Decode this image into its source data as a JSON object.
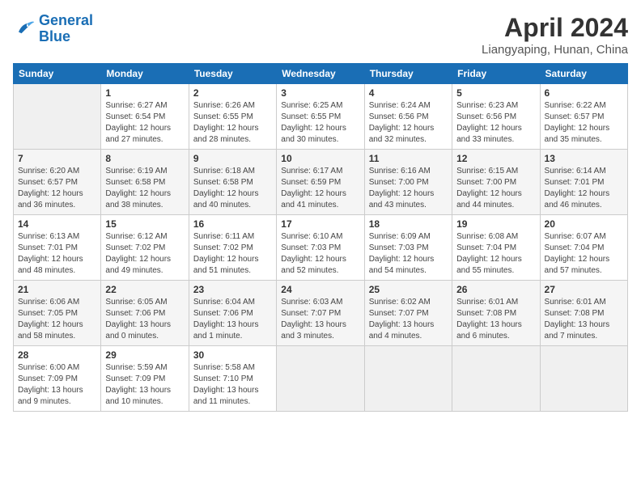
{
  "logo": {
    "line1": "General",
    "line2": "Blue"
  },
  "title": "April 2024",
  "location": "Liangyaping, Hunan, China",
  "days_header": [
    "Sunday",
    "Monday",
    "Tuesday",
    "Wednesday",
    "Thursday",
    "Friday",
    "Saturday"
  ],
  "weeks": [
    [
      {
        "day": "",
        "info": ""
      },
      {
        "day": "1",
        "info": "Sunrise: 6:27 AM\nSunset: 6:54 PM\nDaylight: 12 hours\nand 27 minutes."
      },
      {
        "day": "2",
        "info": "Sunrise: 6:26 AM\nSunset: 6:55 PM\nDaylight: 12 hours\nand 28 minutes."
      },
      {
        "day": "3",
        "info": "Sunrise: 6:25 AM\nSunset: 6:55 PM\nDaylight: 12 hours\nand 30 minutes."
      },
      {
        "day": "4",
        "info": "Sunrise: 6:24 AM\nSunset: 6:56 PM\nDaylight: 12 hours\nand 32 minutes."
      },
      {
        "day": "5",
        "info": "Sunrise: 6:23 AM\nSunset: 6:56 PM\nDaylight: 12 hours\nand 33 minutes."
      },
      {
        "day": "6",
        "info": "Sunrise: 6:22 AM\nSunset: 6:57 PM\nDaylight: 12 hours\nand 35 minutes."
      }
    ],
    [
      {
        "day": "7",
        "info": "Sunrise: 6:20 AM\nSunset: 6:57 PM\nDaylight: 12 hours\nand 36 minutes."
      },
      {
        "day": "8",
        "info": "Sunrise: 6:19 AM\nSunset: 6:58 PM\nDaylight: 12 hours\nand 38 minutes."
      },
      {
        "day": "9",
        "info": "Sunrise: 6:18 AM\nSunset: 6:58 PM\nDaylight: 12 hours\nand 40 minutes."
      },
      {
        "day": "10",
        "info": "Sunrise: 6:17 AM\nSunset: 6:59 PM\nDaylight: 12 hours\nand 41 minutes."
      },
      {
        "day": "11",
        "info": "Sunrise: 6:16 AM\nSunset: 7:00 PM\nDaylight: 12 hours\nand 43 minutes."
      },
      {
        "day": "12",
        "info": "Sunrise: 6:15 AM\nSunset: 7:00 PM\nDaylight: 12 hours\nand 44 minutes."
      },
      {
        "day": "13",
        "info": "Sunrise: 6:14 AM\nSunset: 7:01 PM\nDaylight: 12 hours\nand 46 minutes."
      }
    ],
    [
      {
        "day": "14",
        "info": "Sunrise: 6:13 AM\nSunset: 7:01 PM\nDaylight: 12 hours\nand 48 minutes."
      },
      {
        "day": "15",
        "info": "Sunrise: 6:12 AM\nSunset: 7:02 PM\nDaylight: 12 hours\nand 49 minutes."
      },
      {
        "day": "16",
        "info": "Sunrise: 6:11 AM\nSunset: 7:02 PM\nDaylight: 12 hours\nand 51 minutes."
      },
      {
        "day": "17",
        "info": "Sunrise: 6:10 AM\nSunset: 7:03 PM\nDaylight: 12 hours\nand 52 minutes."
      },
      {
        "day": "18",
        "info": "Sunrise: 6:09 AM\nSunset: 7:03 PM\nDaylight: 12 hours\nand 54 minutes."
      },
      {
        "day": "19",
        "info": "Sunrise: 6:08 AM\nSunset: 7:04 PM\nDaylight: 12 hours\nand 55 minutes."
      },
      {
        "day": "20",
        "info": "Sunrise: 6:07 AM\nSunset: 7:04 PM\nDaylight: 12 hours\nand 57 minutes."
      }
    ],
    [
      {
        "day": "21",
        "info": "Sunrise: 6:06 AM\nSunset: 7:05 PM\nDaylight: 12 hours\nand 58 minutes."
      },
      {
        "day": "22",
        "info": "Sunrise: 6:05 AM\nSunset: 7:06 PM\nDaylight: 13 hours\nand 0 minutes."
      },
      {
        "day": "23",
        "info": "Sunrise: 6:04 AM\nSunset: 7:06 PM\nDaylight: 13 hours\nand 1 minute."
      },
      {
        "day": "24",
        "info": "Sunrise: 6:03 AM\nSunset: 7:07 PM\nDaylight: 13 hours\nand 3 minutes."
      },
      {
        "day": "25",
        "info": "Sunrise: 6:02 AM\nSunset: 7:07 PM\nDaylight: 13 hours\nand 4 minutes."
      },
      {
        "day": "26",
        "info": "Sunrise: 6:01 AM\nSunset: 7:08 PM\nDaylight: 13 hours\nand 6 minutes."
      },
      {
        "day": "27",
        "info": "Sunrise: 6:01 AM\nSunset: 7:08 PM\nDaylight: 13 hours\nand 7 minutes."
      }
    ],
    [
      {
        "day": "28",
        "info": "Sunrise: 6:00 AM\nSunset: 7:09 PM\nDaylight: 13 hours\nand 9 minutes."
      },
      {
        "day": "29",
        "info": "Sunrise: 5:59 AM\nSunset: 7:09 PM\nDaylight: 13 hours\nand 10 minutes."
      },
      {
        "day": "30",
        "info": "Sunrise: 5:58 AM\nSunset: 7:10 PM\nDaylight: 13 hours\nand 11 minutes."
      },
      {
        "day": "",
        "info": ""
      },
      {
        "day": "",
        "info": ""
      },
      {
        "day": "",
        "info": ""
      },
      {
        "day": "",
        "info": ""
      }
    ]
  ]
}
